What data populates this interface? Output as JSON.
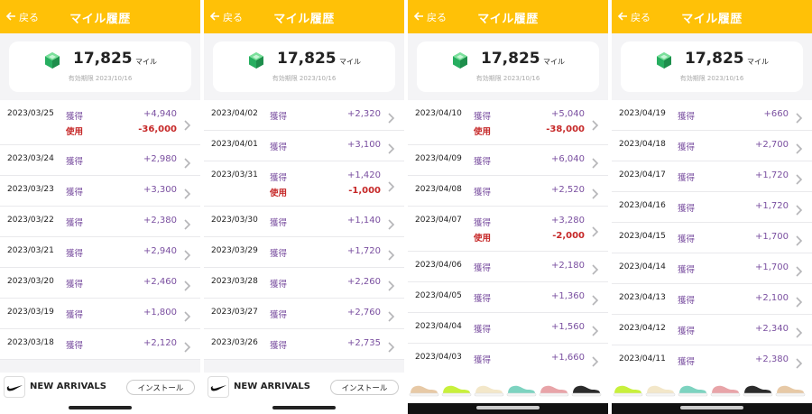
{
  "colors": {
    "header": "#ffc107",
    "gain": "#7a4fa0",
    "use": "#c62828",
    "gem": "#2ecc71"
  },
  "panels": [
    {
      "back_label": "戻る",
      "title": "マイル履歴",
      "miles": "17,825",
      "unit": "マイル",
      "expiry": "有効期限 2023/10/16",
      "ad": {
        "text": "NEW ARRIVALS",
        "install": "インストール"
      },
      "rows": [
        {
          "date": "2023/03/25",
          "label1": "獲得",
          "amount1": "+4,940",
          "label2": "使用",
          "amount2": "-36,000"
        },
        {
          "date": "2023/03/24",
          "label1": "獲得",
          "amount1": "+2,980"
        },
        {
          "date": "2023/03/23",
          "label1": "獲得",
          "amount1": "+3,300"
        },
        {
          "date": "2023/03/22",
          "label1": "獲得",
          "amount1": "+2,380"
        },
        {
          "date": "2023/03/21",
          "label1": "獲得",
          "amount1": "+2,940"
        },
        {
          "date": "2023/03/20",
          "label1": "獲得",
          "amount1": "+2,460"
        },
        {
          "date": "2023/03/19",
          "label1": "獲得",
          "amount1": "+1,800"
        },
        {
          "date": "2023/03/18",
          "label1": "獲得",
          "amount1": "+2,120"
        }
      ]
    },
    {
      "back_label": "戻る",
      "title": "マイル履歴",
      "miles": "17,825",
      "unit": "マイル",
      "expiry": "有効期限 2023/10/16",
      "ad": {
        "text": "NEW ARRIVALS",
        "install": "インストール"
      },
      "rows": [
        {
          "date": "2023/04/02",
          "label1": "獲得",
          "amount1": "+2,320"
        },
        {
          "date": "2023/04/01",
          "label1": "獲得",
          "amount1": "+3,100"
        },
        {
          "date": "2023/03/31",
          "label1": "獲得",
          "amount1": "+1,420",
          "label2": "使用",
          "amount2": "-1,000"
        },
        {
          "date": "2023/03/30",
          "label1": "獲得",
          "amount1": "+1,140"
        },
        {
          "date": "2023/03/29",
          "label1": "獲得",
          "amount1": "+1,720"
        },
        {
          "date": "2023/03/28",
          "label1": "獲得",
          "amount1": "+2,260"
        },
        {
          "date": "2023/03/27",
          "label1": "獲得",
          "amount1": "+2,760"
        },
        {
          "date": "2023/03/26",
          "label1": "獲得",
          "amount1": "+2,735"
        }
      ]
    },
    {
      "back_label": "戻る",
      "title": "マイル履歴",
      "miles": "17,825",
      "unit": "マイル",
      "expiry": "有効期限 2023/10/16",
      "rows": [
        {
          "date": "2023/04/10",
          "label1": "獲得",
          "amount1": "+5,040",
          "label2": "使用",
          "amount2": "-38,000"
        },
        {
          "date": "2023/04/09",
          "label1": "獲得",
          "amount1": "+6,040"
        },
        {
          "date": "2023/04/08",
          "label1": "獲得",
          "amount1": "+2,520"
        },
        {
          "date": "2023/04/07",
          "label1": "獲得",
          "amount1": "+3,280",
          "label2": "使用",
          "amount2": "-2,000"
        },
        {
          "date": "2023/04/06",
          "label1": "獲得",
          "amount1": "+2,180"
        },
        {
          "date": "2023/04/05",
          "label1": "獲得",
          "amount1": "+1,360"
        },
        {
          "date": "2023/04/04",
          "label1": "獲得",
          "amount1": "+1,560"
        },
        {
          "date": "2023/04/03",
          "label1": "獲得",
          "amount1": "+1,660"
        }
      ]
    },
    {
      "back_label": "戻る",
      "title": "マイル履歴",
      "miles": "17,825",
      "unit": "マイル",
      "expiry": "有効期限 2023/10/16",
      "rows": [
        {
          "date": "2023/04/19",
          "label1": "獲得",
          "amount1": "+660"
        },
        {
          "date": "2023/04/18",
          "label1": "獲得",
          "amount1": "+2,700"
        },
        {
          "date": "2023/04/17",
          "label1": "獲得",
          "amount1": "+1,720"
        },
        {
          "date": "2023/04/16",
          "label1": "獲得",
          "amount1": "+1,720"
        },
        {
          "date": "2023/04/15",
          "label1": "獲得",
          "amount1": "+1,700"
        },
        {
          "date": "2023/04/14",
          "label1": "獲得",
          "amount1": "+1,700"
        },
        {
          "date": "2023/04/13",
          "label1": "獲得",
          "amount1": "+2,100"
        },
        {
          "date": "2023/04/12",
          "label1": "獲得",
          "amount1": "+2,340"
        },
        {
          "date": "2023/04/11",
          "label1": "獲得",
          "amount1": "+2,380"
        }
      ]
    }
  ]
}
